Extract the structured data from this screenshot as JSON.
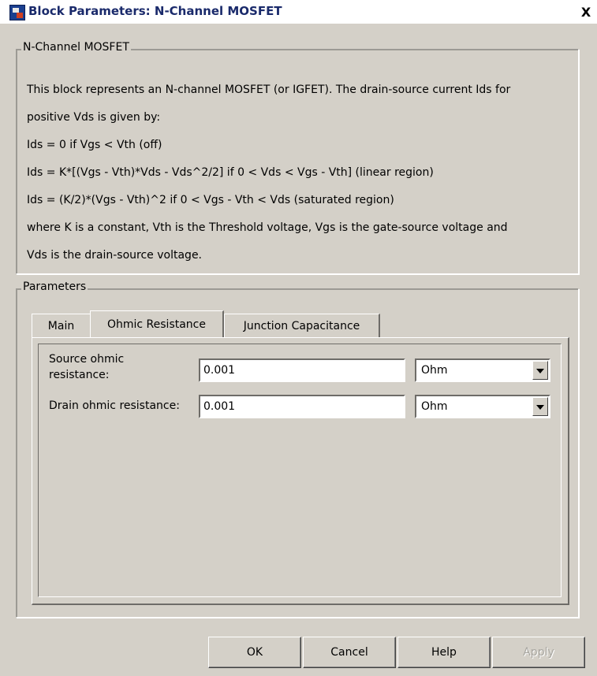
{
  "window": {
    "title": "Block Parameters: N-Channel MOSFET",
    "close_symbol": "X"
  },
  "description_group": {
    "legend": "N-Channel MOSFET",
    "paragraphs": [
      "This block represents an N-channel MOSFET (or IGFET). The drain-source current Ids for",
      "positive Vds is given by:",
      "Ids = 0 if Vgs < Vth (off)",
      "Ids = K*[(Vgs - Vth)*Vds - Vds^2/2] if 0 < Vds < Vgs - Vth] (linear region)",
      "Ids = (K/2)*(Vgs - Vth)^2 if 0 < Vgs - Vth < Vds (saturated region)",
      "where K is a constant, Vth is the Threshold voltage, Vgs is the gate-source voltage and",
      "Vds is the drain-source voltage."
    ]
  },
  "parameters_group": {
    "legend": "Parameters",
    "tabs": [
      {
        "label": "Main"
      },
      {
        "label": "Ohmic Resistance"
      },
      {
        "label": "Junction Capacitance"
      }
    ],
    "active_tab": "Ohmic Resistance",
    "fields": [
      {
        "label_line1": "Source ohmic",
        "label_line2": "resistance:",
        "value": "0.001",
        "unit": "Ohm"
      },
      {
        "label_line1": "Drain ohmic resistance:",
        "value": "0.001",
        "unit": "Ohm"
      }
    ]
  },
  "buttons": {
    "ok": "OK",
    "cancel": "Cancel",
    "help": "Help",
    "apply": "Apply"
  },
  "icons": [
    "simulink-block-icon",
    "close-icon",
    "dropdown-arrow-icon"
  ]
}
